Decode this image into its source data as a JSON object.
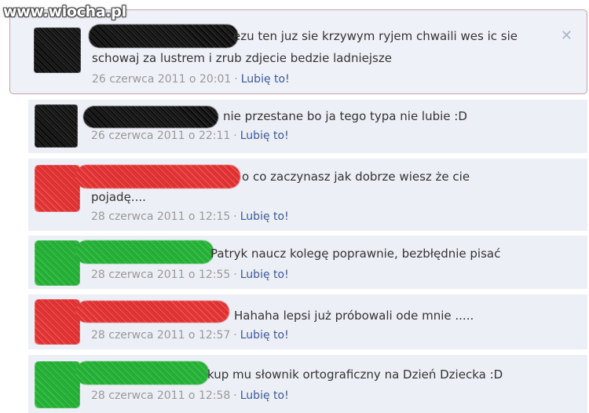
{
  "watermark": "www.wiocha.pl",
  "comments": [
    {
      "text": "ezu ten juz sie krzywym ryjem chwaili wes ic sie schowaj za lustrem i zrub zdjecie bedzie ladniejsze",
      "line1": "ezu ten juz sie krzywym ryjem chwaili wes ic sie",
      "line2": "schowaj za lustrem i zrub zdjecie bedzie ladniejsze",
      "date": "26 czerwca 2011 o 20:01",
      "like": "Lubię to!",
      "scribble_color": "black"
    },
    {
      "line1": "nie przestane bo ja tego typa nie lubie :D",
      "date": "26 czerwca 2011 o 22:11",
      "like": "Lubię to!",
      "scribble_color": "black"
    },
    {
      "line1": "o co zaczynasz jak dobrze wiesz że cie",
      "line2": "pojadę....",
      "date": "28 czerwca 2011 o 12:15",
      "like": "Lubię to!",
      "scribble_color": "red"
    },
    {
      "line1": "Patryk naucz kolegę poprawnie, bezbłędnie pisać",
      "date": "28 czerwca 2011 o 12:55",
      "like": "Lubię to!",
      "scribble_color": "green"
    },
    {
      "line1": "Hahaha lepsi już próbowali ode mnie .....",
      "date": "28 czerwca 2011 o 12:57",
      "like": "Lubię to!",
      "scribble_color": "red"
    },
    {
      "line1": "kup mu słownik ortograficzny na Dzień Dziecka :D",
      "date": "28 czerwca 2011 o 12:58",
      "like": "Lubię to!",
      "scribble_color": "green"
    }
  ],
  "close_label": "✕",
  "separator": "·"
}
